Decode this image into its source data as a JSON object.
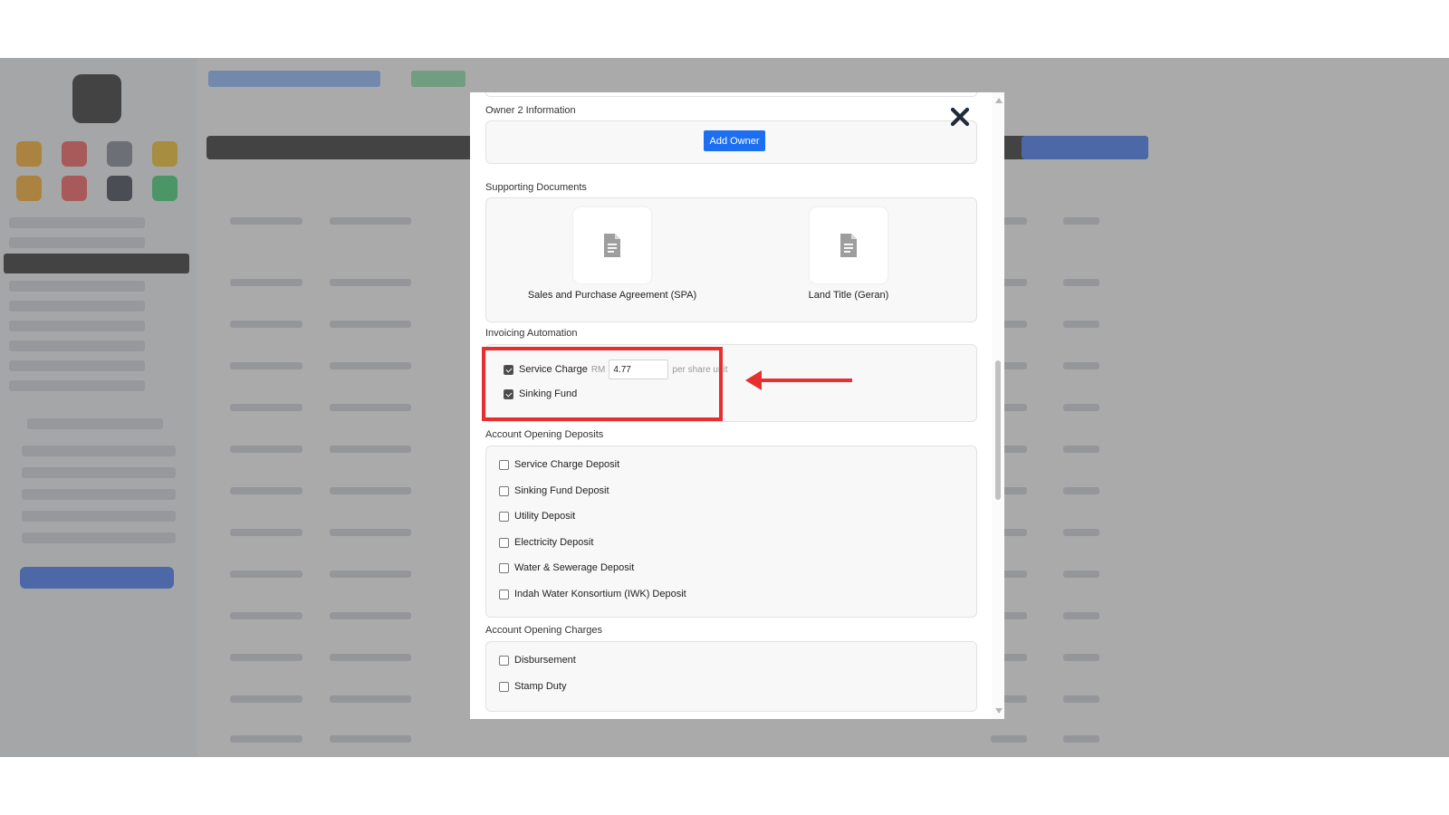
{
  "modal": {
    "owner2": {
      "title": "Owner 2 Information",
      "add_owner_label": "Add Owner"
    },
    "supporting_documents": {
      "title": "Supporting Documents",
      "documents": [
        {
          "label": "Sales and Purchase Agreement (SPA)",
          "icon": "document-icon"
        },
        {
          "label": "Land Title (Geran)",
          "icon": "document-icon"
        }
      ]
    },
    "invoicing_automation": {
      "title": "Invoicing Automation",
      "service_charge": {
        "label": "Service Charge",
        "checked": true,
        "currency": "RM",
        "value": "4.77",
        "unit": "per share unit"
      },
      "sinking_fund": {
        "label": "Sinking Fund",
        "checked": true
      }
    },
    "account_opening_deposits": {
      "title": "Account Opening Deposits",
      "items": [
        {
          "label": "Service Charge Deposit",
          "checked": false
        },
        {
          "label": "Sinking Fund Deposit",
          "checked": false
        },
        {
          "label": "Utility Deposit",
          "checked": false
        },
        {
          "label": "Electricity Deposit",
          "checked": false
        },
        {
          "label": "Water & Sewerage Deposit",
          "checked": false
        },
        {
          "label": "Indah Water Konsortium (IWK) Deposit",
          "checked": false
        }
      ]
    },
    "account_opening_charges": {
      "title": "Account Opening Charges",
      "items": [
        {
          "label": "Disbursement",
          "checked": false
        },
        {
          "label": "Stamp Duty",
          "checked": false
        }
      ]
    }
  },
  "colors": {
    "primary_button": "#1d6ff2",
    "highlight_box": "#e63030",
    "overlay": "rgba(110,110,110,0.55)"
  }
}
